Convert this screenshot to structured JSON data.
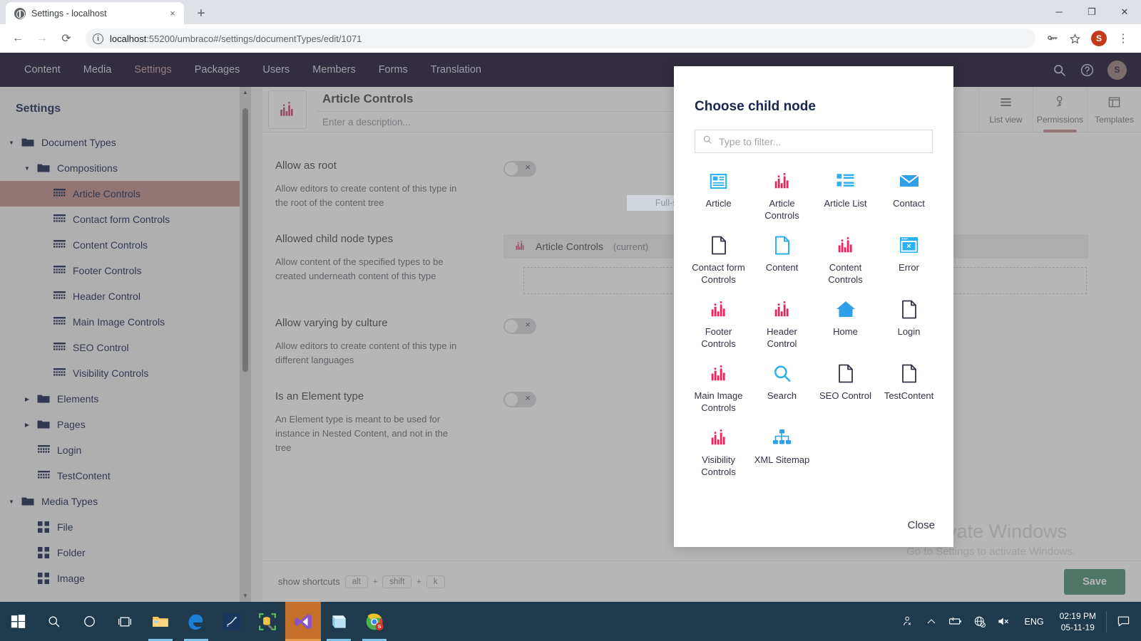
{
  "browser": {
    "tab_title": "Settings - localhost",
    "tab_close": "×",
    "newtab": "+",
    "back": "←",
    "forward": "→",
    "reload": "⟳",
    "info_icon": "i",
    "url_prefix": "localhost",
    "url_rest": ":55200/umbraco#/settings/documentTypes/edit/1071",
    "url_full": "localhost:55200/umbraco#/settings/documentTypes/edit/1071",
    "profile_initial": "S",
    "minimize": "─",
    "maximize": "❐",
    "close": "✕",
    "menu": "⋮"
  },
  "umbraco": {
    "nav": [
      {
        "label": "Content",
        "active": false
      },
      {
        "label": "Media",
        "active": false
      },
      {
        "label": "Settings",
        "active": true
      },
      {
        "label": "Packages",
        "active": false
      },
      {
        "label": "Users",
        "active": false
      },
      {
        "label": "Members",
        "active": false
      },
      {
        "label": "Forms",
        "active": false
      },
      {
        "label": "Translation",
        "active": false
      }
    ],
    "user_initial": "S",
    "tree": {
      "title": "Settings",
      "items": [
        {
          "label": "Document Types",
          "indent": 0,
          "caret": "down",
          "icon": "folder",
          "selected": false
        },
        {
          "label": "Compositions",
          "indent": 1,
          "caret": "down",
          "icon": "folder",
          "selected": false
        },
        {
          "label": "Article Controls",
          "indent": 2,
          "caret": "none",
          "icon": "grid",
          "selected": true
        },
        {
          "label": "Contact form Controls",
          "indent": 2,
          "caret": "none",
          "icon": "grid",
          "selected": false
        },
        {
          "label": "Content Controls",
          "indent": 2,
          "caret": "none",
          "icon": "grid",
          "selected": false
        },
        {
          "label": "Footer Controls",
          "indent": 2,
          "caret": "none",
          "icon": "grid",
          "selected": false
        },
        {
          "label": "Header Control",
          "indent": 2,
          "caret": "none",
          "icon": "grid",
          "selected": false
        },
        {
          "label": "Main Image Controls",
          "indent": 2,
          "caret": "none",
          "icon": "grid",
          "selected": false
        },
        {
          "label": "SEO Control",
          "indent": 2,
          "caret": "none",
          "icon": "grid",
          "selected": false
        },
        {
          "label": "Visibility Controls",
          "indent": 2,
          "caret": "none",
          "icon": "grid",
          "selected": false
        },
        {
          "label": "Elements",
          "indent": 1,
          "caret": "right",
          "icon": "folder",
          "selected": false
        },
        {
          "label": "Pages",
          "indent": 1,
          "caret": "right",
          "icon": "folder",
          "selected": false
        },
        {
          "label": "Login",
          "indent": 1,
          "caret": "none",
          "icon": "grid",
          "selected": false
        },
        {
          "label": "TestContent",
          "indent": 1,
          "caret": "none",
          "icon": "grid",
          "selected": false
        },
        {
          "label": "Media Types",
          "indent": 0,
          "caret": "down",
          "icon": "folder",
          "selected": false
        },
        {
          "label": "File",
          "indent": 1,
          "caret": "none",
          "icon": "grid4",
          "selected": false
        },
        {
          "label": "Folder",
          "indent": 1,
          "caret": "none",
          "icon": "grid4",
          "selected": false
        },
        {
          "label": "Image",
          "indent": 1,
          "caret": "none",
          "icon": "grid4",
          "selected": false
        }
      ]
    },
    "editor": {
      "name": "Article Controls",
      "description_placeholder": "Enter a description...",
      "tabs": [
        {
          "label": "List view",
          "icon": "list-icon",
          "active": false
        },
        {
          "label": "Permissions",
          "icon": "permissions-icon",
          "active": true
        },
        {
          "label": "Templates",
          "icon": "templates-icon",
          "active": false
        }
      ],
      "properties": [
        {
          "name": "Allow as root",
          "description": "Allow editors to create content of this type in the root of the content tree",
          "control": "toggle",
          "value": "off",
          "off_mark": "×"
        },
        {
          "name": "Allowed child node types",
          "description": "Allow content of the specified types to be created underneath content of this type",
          "control": "nodelist",
          "nodes": [
            {
              "label": "Article Controls",
              "suffix": "(current)"
            }
          ]
        },
        {
          "name": "Allow varying by culture",
          "description": "Allow editors to create content of this type in different languages",
          "control": "toggle",
          "value": "off",
          "off_mark": "×"
        },
        {
          "name": "Is an Element type",
          "description": "An Element type is meant to be used for instance in Nested Content, and not in the tree",
          "control": "toggle",
          "value": "off",
          "off_mark": "×"
        }
      ],
      "footer": {
        "shortcuts_label": "show shortcuts",
        "key1": "alt",
        "plus1": "+",
        "key2": "shift",
        "plus2": "+",
        "key3": "k",
        "save_label": "Save"
      }
    }
  },
  "modal": {
    "title": "Choose child node",
    "filter_placeholder": "Type to filter...",
    "filter_value": "",
    "close_label": "Close",
    "nodes": [
      {
        "label": "Article",
        "icon": "article-icon",
        "color": "#2bb0f0"
      },
      {
        "label": "Article Controls",
        "icon": "chart-bars-icon",
        "color": "#e8245c"
      },
      {
        "label": "Article List",
        "icon": "list-blocks-icon",
        "color": "#2bb0f0"
      },
      {
        "label": "Contact",
        "icon": "envelope-icon",
        "color": "#2e9fe8"
      },
      {
        "label": "Contact form Controls",
        "icon": "page-outline-icon",
        "color": "#33334a"
      },
      {
        "label": "Content",
        "icon": "document-icon",
        "color": "#2bb0f0"
      },
      {
        "label": "Content Controls",
        "icon": "chart-bars-icon",
        "color": "#e8245c"
      },
      {
        "label": "Error",
        "icon": "browser-error-icon",
        "color": "#2bb0f0"
      },
      {
        "label": "Footer Controls",
        "icon": "chart-bars-icon",
        "color": "#e8245c"
      },
      {
        "label": "Header Control",
        "icon": "chart-bars-icon",
        "color": "#e8245c"
      },
      {
        "label": "Home",
        "icon": "home-icon",
        "color": "#2e9fe8"
      },
      {
        "label": "Login",
        "icon": "page-outline-icon",
        "color": "#33334a"
      },
      {
        "label": "Main Image Controls",
        "icon": "chart-bars-icon",
        "color": "#e8245c"
      },
      {
        "label": "Search",
        "icon": "search-icon",
        "color": "#2bb0f0"
      },
      {
        "label": "SEO Control",
        "icon": "page-outline-icon",
        "color": "#33334a"
      },
      {
        "label": "TestContent",
        "icon": "page-outline-icon",
        "color": "#33334a"
      },
      {
        "label": "Visibility Controls",
        "icon": "chart-bars-icon",
        "color": "#e8245c"
      },
      {
        "label": "XML Sitemap",
        "icon": "sitemap-icon",
        "color": "#2e9fe8"
      }
    ]
  },
  "overlay_tooltip": "Full-screen Snip",
  "watermark": {
    "line1": "Activate Windows",
    "line2": "Go to Settings to activate Windows."
  },
  "taskbar": {
    "apps": [
      {
        "name": "file-explorer",
        "state": "running"
      },
      {
        "name": "edge",
        "state": "running"
      },
      {
        "name": "sql-server",
        "state": "none"
      },
      {
        "name": "sql-tools",
        "state": "none"
      },
      {
        "name": "visual-studio",
        "state": "active"
      },
      {
        "name": "notepad",
        "state": "running"
      },
      {
        "name": "chrome",
        "state": "running"
      }
    ],
    "language": "ENG",
    "time": "02:19 PM",
    "date": "05-11-19"
  }
}
